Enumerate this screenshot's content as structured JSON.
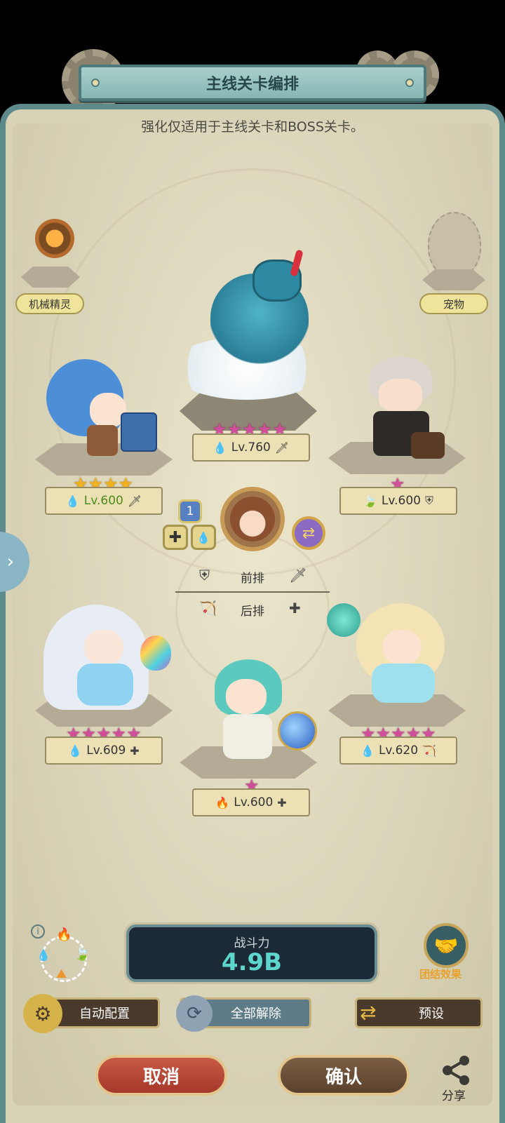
{
  "header": {
    "title": "主线关卡编排"
  },
  "subtitle": "强化仅适用于主线关卡和BOSS关卡。",
  "side_slots": {
    "left_label": "机械精灵",
    "right_label": "宠物"
  },
  "heroes": [
    {
      "id": "dragon",
      "level": "Lv.760",
      "stars": "★★★★★",
      "element": "water-drop-icon",
      "role": "sword-icon"
    },
    {
      "id": "blue-hair-girl",
      "level": "Lv.600",
      "stars": "★★★★",
      "element": "water-drop-icon",
      "role": "sword-icon"
    },
    {
      "id": "white-hair-man",
      "level": "Lv.600",
      "stars": "★",
      "element": "leaf-icon",
      "role": "shield-icon"
    },
    {
      "id": "ice-queen",
      "level": "Lv.609",
      "stars": "★★★★★",
      "element": "water-drop-icon",
      "role": "plus-icon"
    },
    {
      "id": "cyan-priestess",
      "level": "Lv.600",
      "stars": "★",
      "element": "fire-icon",
      "role": "plus-icon"
    },
    {
      "id": "blonde-mage",
      "level": "Lv.620",
      "stars": "★★★★★",
      "element": "water-drop-icon",
      "role": "bow-icon"
    }
  ],
  "leader": {
    "badge": "1"
  },
  "rows": {
    "front": "前排",
    "back": "后排"
  },
  "power": {
    "label": "战斗力",
    "value": "4.9B"
  },
  "team_effect": "团结效果",
  "buttons": {
    "auto": "自动配置",
    "release_all": "全部解除",
    "preset": "预设",
    "cancel": "取消",
    "confirm": "确认",
    "share": "分享"
  },
  "colors": {
    "accent": "#5fd6cc",
    "panel": "#d8d2b6",
    "frame": "#5e8a8c",
    "star_pink": "#d04f9a",
    "star_gold": "#f0b21e"
  }
}
